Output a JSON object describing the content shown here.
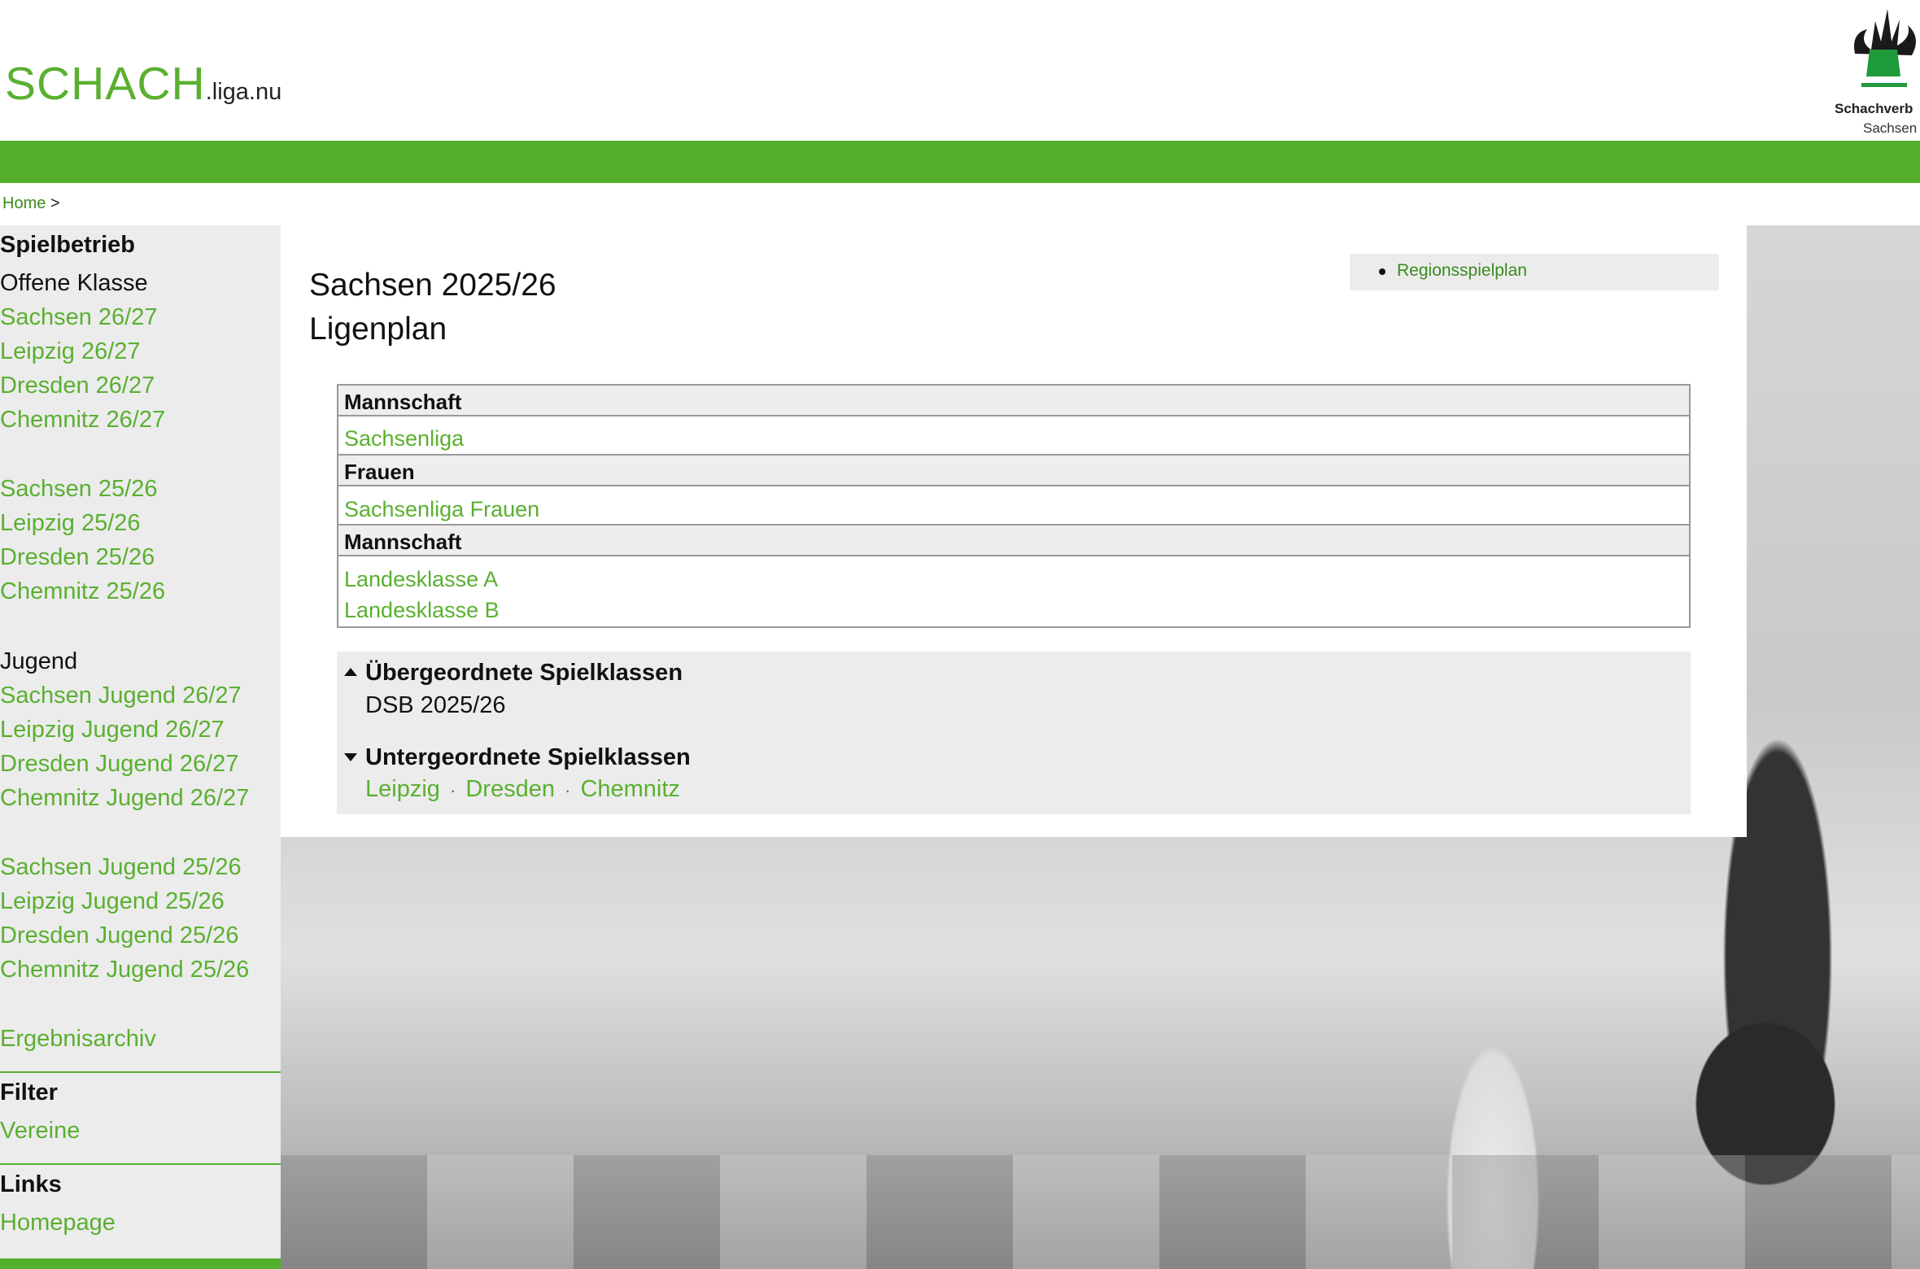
{
  "header": {
    "logo_main": "SCHACH",
    "logo_suffix": ".liga.nu",
    "emblem_line1": "Schachverb",
    "emblem_line2": "Sachsen"
  },
  "breadcrumb": {
    "home": "Home",
    "separator": ">"
  },
  "sidebar": {
    "spielbetrieb_heading": "Spielbetrieb",
    "offene_klasse_label": "Offene Klasse",
    "offene_links": [
      "Sachsen 26/27",
      "Leipzig 26/27",
      "Dresden 26/27",
      "Chemnitz 26/27",
      "Sachsen 25/26",
      "Leipzig 25/26",
      "Dresden 25/26",
      "Chemnitz 25/26"
    ],
    "jugend_label": "Jugend",
    "jugend_links": [
      "Sachsen Jugend 26/27",
      "Leipzig Jugend 26/27",
      "Dresden Jugend 26/27",
      "Chemnitz Jugend 26/27",
      "Sachsen Jugend 25/26",
      "Leipzig Jugend 25/26",
      "Dresden Jugend 25/26",
      "Chemnitz Jugend 25/26"
    ],
    "archiv_link": "Ergebnisarchiv",
    "filter_heading": "Filter",
    "vereine_link": "Vereine",
    "links_heading": "Links",
    "homepage_link": "Homepage"
  },
  "main": {
    "title_line1": "Sachsen 2025/26",
    "title_line2": "Ligenplan",
    "region_link": "Regionsspielplan",
    "ligen": {
      "group1_header": "Mannschaft",
      "group1_items": [
        "Sachsenliga"
      ],
      "group2_header": "Frauen",
      "group2_items": [
        "Sachsenliga Frauen"
      ],
      "group3_header": "Mannschaft",
      "group3_items": [
        "Landesklasse A",
        "Landesklasse B"
      ]
    },
    "uebergeordnet_heading": "Übergeordnete Spielklassen",
    "uebergeordnet_value": "DSB 2025/26",
    "untergeordnet_heading": "Untergeordnete Spielklassen",
    "untergeordnet_links": [
      "Leipzig",
      "Dresden",
      "Chemnitz"
    ],
    "untergeordnet_separator": "·"
  },
  "colors": {
    "accent": "#54b02c",
    "link": "#5ab030",
    "panel_gray": "#ececec"
  }
}
